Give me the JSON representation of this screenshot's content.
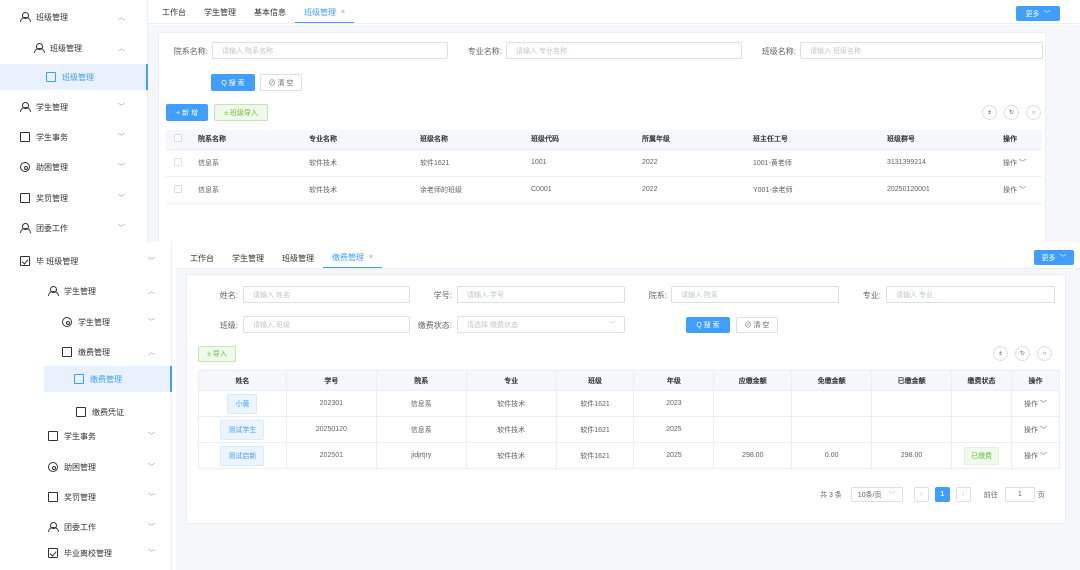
{
  "colors": {
    "primary": "#409eff",
    "success": "#67c23a",
    "border": "#dcdfe6",
    "header_bg": "#f5f7fa"
  },
  "top": {
    "sidebar": {
      "items": [
        {
          "label": "班级管理",
          "icon": "user-group-icon"
        },
        {
          "label": "班级管理",
          "icon": "user-group-icon"
        },
        {
          "label": "班级管理",
          "icon": "id-card-icon",
          "active": true
        },
        {
          "label": "学生管理",
          "icon": "user-icon"
        },
        {
          "label": "学生事务",
          "icon": "clipboard-icon"
        },
        {
          "label": "助困管理",
          "icon": "gear-icon"
        },
        {
          "label": "奖罚管理",
          "icon": "award-icon"
        },
        {
          "label": "团委工作",
          "icon": "team-icon"
        }
      ]
    },
    "tabs": [
      {
        "label": "工作台"
      },
      {
        "label": "学生管理"
      },
      {
        "label": "基本信息"
      },
      {
        "label": "班级管理",
        "active": true
      }
    ],
    "more_label": "更多",
    "filters": [
      {
        "label": "院系名称:",
        "placeholder": "请输入 院系名称"
      },
      {
        "label": "专业名称:",
        "placeholder": "请输入 专业名称"
      },
      {
        "label": "班级名称:",
        "placeholder": "请输入 班级名称"
      }
    ],
    "search_label": "Q 搜 索",
    "reset_label": "⊘ 清 空",
    "add_label": "+ 新 增",
    "import_label": "± 班级导入",
    "table": {
      "columns": [
        "院系名称",
        "专业名称",
        "班级名称",
        "班级代码",
        "所属年级",
        "班主任工号",
        "班级群号",
        "操作"
      ],
      "rows": [
        [
          "信息系",
          "软件技术",
          "软件1621",
          "1001",
          "2022",
          "1001-黄老师",
          "3131399214",
          "操作"
        ],
        [
          "信息系",
          "软件技术",
          "余老师的班级",
          "C0001",
          "2022",
          "Y001-余老师",
          "20250120001",
          "操作"
        ]
      ]
    }
  },
  "bottom": {
    "sidebar": {
      "items": [
        {
          "label": "毕  班级管理",
          "icon": "check-square-icon"
        },
        {
          "label": "学生管理",
          "icon": "user-icon"
        },
        {
          "label": "学生管理",
          "icon": "gear-icon"
        },
        {
          "label": "缴费管理",
          "icon": "clipboard-icon"
        },
        {
          "label": "缴费管理",
          "icon": "id-card-icon",
          "active": true
        },
        {
          "label": "缴费凭证",
          "icon": "receipt-icon"
        },
        {
          "label": "学生事务",
          "icon": "clipboard-icon"
        },
        {
          "label": "助困管理",
          "icon": "gear-icon"
        },
        {
          "label": "奖罚管理",
          "icon": "award-icon"
        },
        {
          "label": "团委工作",
          "icon": "team-icon"
        },
        {
          "label": "毕业离校管理",
          "icon": "check-square-icon"
        }
      ]
    },
    "tabs": [
      {
        "label": "工作台"
      },
      {
        "label": "学生管理"
      },
      {
        "label": "班级管理"
      },
      {
        "label": "缴费管理",
        "active": true
      }
    ],
    "more_label": "更多",
    "filters": [
      {
        "label": "姓名:",
        "placeholder": "请输入 姓名"
      },
      {
        "label": "学号:",
        "placeholder": "请输入 学号"
      },
      {
        "label": "院系:",
        "placeholder": "请输入 院系"
      },
      {
        "label": "专业:",
        "placeholder": "请输入 专业"
      },
      {
        "label": "班级:",
        "placeholder": "请输入 班级"
      },
      {
        "label": "缴费状态:",
        "placeholder": "请选择 缴费状态"
      }
    ],
    "search_label": "Q 搜 索",
    "reset_label": "⊘ 清 空",
    "import_label": "± 导入",
    "table": {
      "columns": [
        "姓名",
        "学号",
        "院系",
        "专业",
        "班级",
        "年级",
        "应缴金额",
        "免缴金额",
        "已缴金额",
        "缴费状态",
        "操作"
      ],
      "rows": [
        [
          "小黄",
          "202301",
          "信息系",
          "软件技术",
          "软件1621",
          "2023",
          "",
          "",
          "",
          "",
          "操作"
        ],
        [
          "测试学生",
          "20250120",
          "信息系",
          "软件技术",
          "软件1621",
          "2025",
          "",
          "",
          "",
          "",
          "操作"
        ],
        [
          "测试启新",
          "202501",
          "jidjrtjry",
          "软件技术",
          "软件1621",
          "2025",
          "298.00",
          "0.00",
          "298.00",
          "已缴费",
          "操作"
        ]
      ]
    },
    "pagination": {
      "total": "共 3 条",
      "page_size": "10条/页",
      "current": "1",
      "goto_label": "前往",
      "goto_value": "1",
      "page_unit": "页"
    }
  }
}
